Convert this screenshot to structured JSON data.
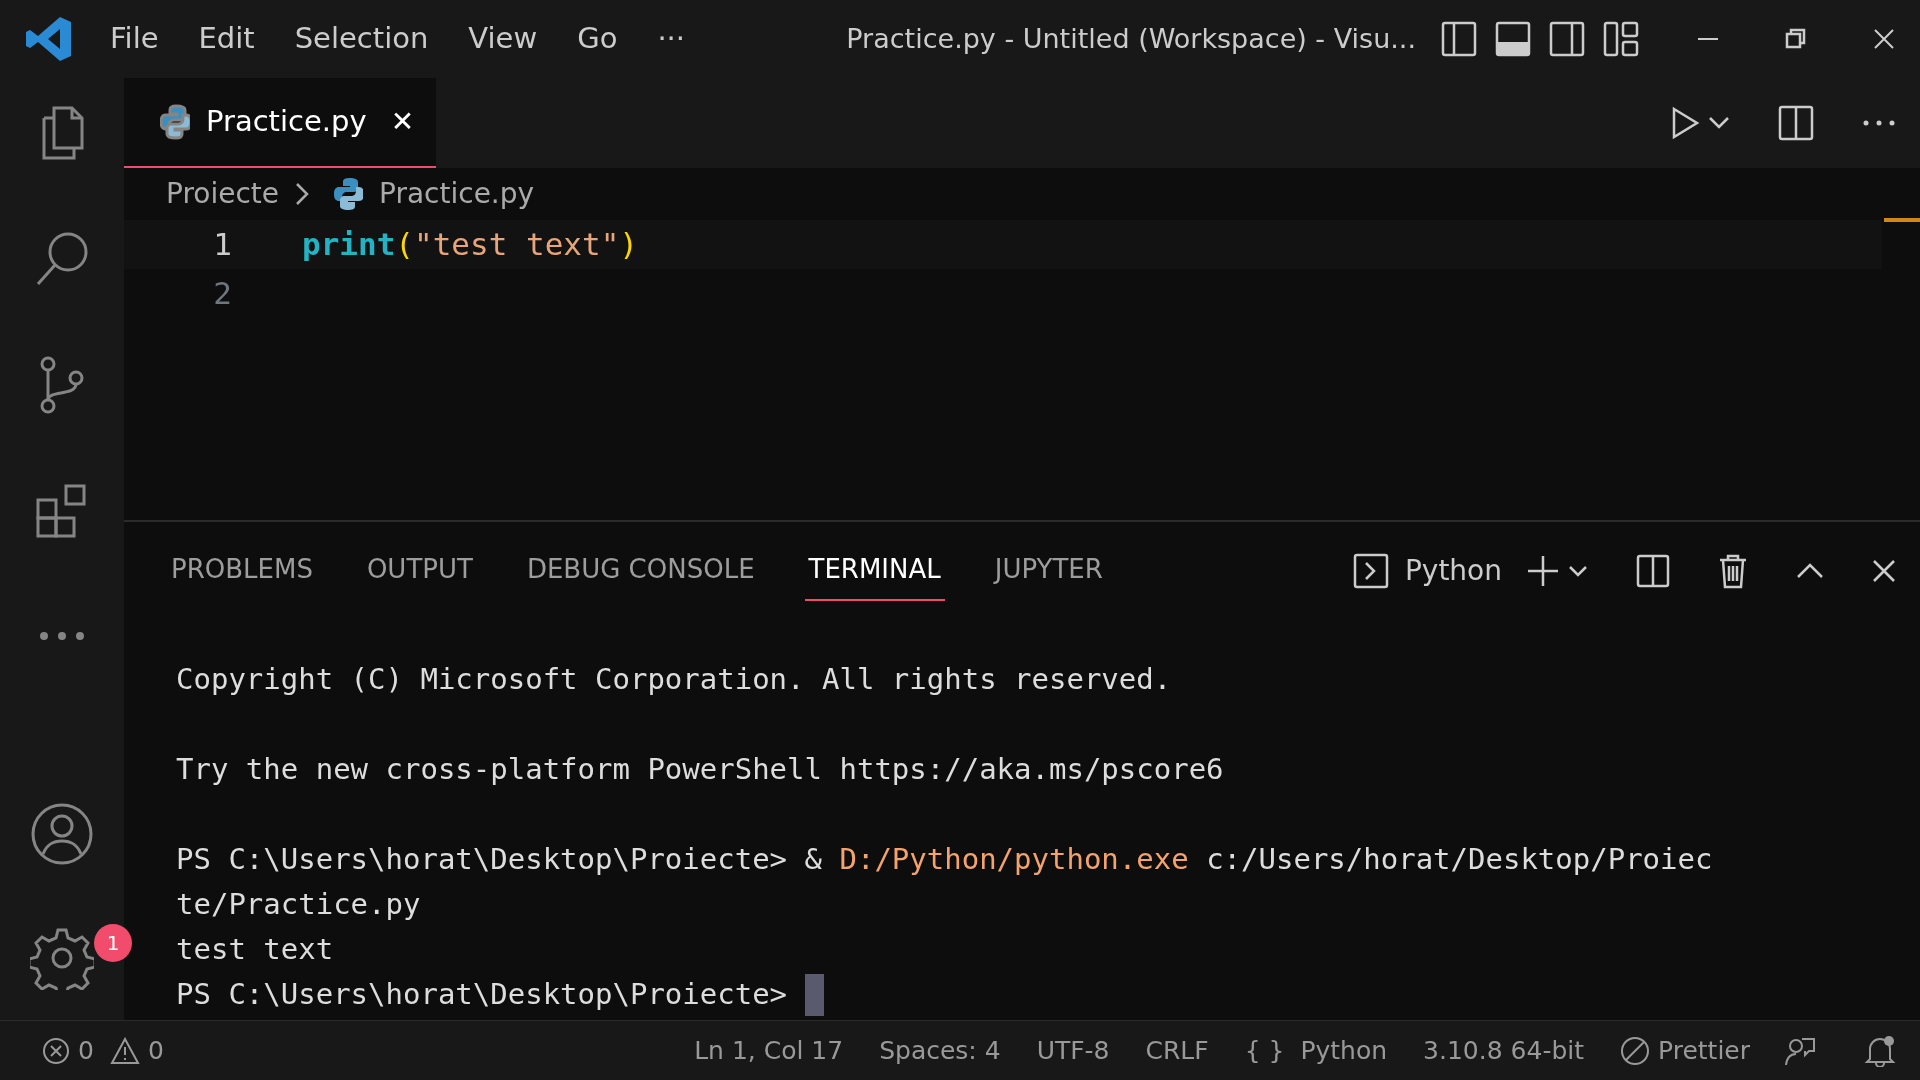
{
  "menu": [
    "File",
    "Edit",
    "Selection",
    "View",
    "Go",
    "···"
  ],
  "window": {
    "title": "Practice.py - Untitled (Workspace) - Visu..."
  },
  "activity_bar": {
    "settings_badge": "1"
  },
  "editor_tabs": [
    {
      "label": "Practice.py",
      "selected": true,
      "close": "✕"
    }
  ],
  "breadcrumb": [
    "Proiecte",
    "Practice.py"
  ],
  "code_lines": [
    {
      "number": "1",
      "current": true,
      "tokens": [
        {
          "kind": "function",
          "text": "print"
        },
        {
          "kind": "bracket",
          "text": "("
        },
        {
          "kind": "string",
          "text": "\"test text\""
        },
        {
          "kind": "bracket",
          "text": ")"
        }
      ]
    },
    {
      "number": "2",
      "current": false
    }
  ],
  "panel_tabs": [
    {
      "label": "PROBLEMS",
      "selected": false
    },
    {
      "label": "OUTPUT",
      "selected": false
    },
    {
      "label": "DEBUG CONSOLE",
      "selected": false
    },
    {
      "label": "TERMINAL",
      "selected": true
    },
    {
      "label": "JUPYTER",
      "selected": false
    }
  ],
  "terminal_profile": "Python",
  "terminal_blocks": [
    {
      "lines": [
        {
          "cursor": false,
          "parts": [
            {
              "kind": "text",
              "text": "Copyright (C) Microsoft Corporation. All rights reserved."
            }
          ]
        }
      ]
    },
    {
      "lines": [
        {
          "cursor": false,
          "parts": [
            {
              "kind": "text",
              "text": "Try the new cross-platform PowerShell https://aka.ms/pscore6"
            }
          ]
        }
      ]
    },
    {
      "lines": [
        {
          "cursor": false,
          "parts": [
            {
              "kind": "text",
              "text": "PS C:\\Users\\horat\\Desktop\\Proiecte> & "
            },
            {
              "kind": "command",
              "text": "D:/Python/python.exe"
            },
            {
              "kind": "text",
              "text": " c:/Users/horat/Desktop/Proiec"
            }
          ]
        },
        {
          "cursor": false,
          "parts": [
            {
              "kind": "text",
              "text": "te/Practice.py"
            }
          ]
        },
        {
          "cursor": false,
          "parts": [
            {
              "kind": "text",
              "text": "test text"
            }
          ]
        },
        {
          "cursor": true,
          "parts": [
            {
              "kind": "text",
              "text": "PS C:\\Users\\horat\\Desktop\\Proiecte> "
            }
          ]
        }
      ]
    }
  ],
  "status_bar": {
    "errors": "0",
    "warnings": "0",
    "items": [
      "Ln 1, Col 17",
      "Spaces: 4",
      "UTF-8",
      "CRLF"
    ],
    "language_icon": "{ }",
    "language": "Python",
    "interpreter": "3.10.8 64-bit",
    "formatter": "Prettier"
  }
}
